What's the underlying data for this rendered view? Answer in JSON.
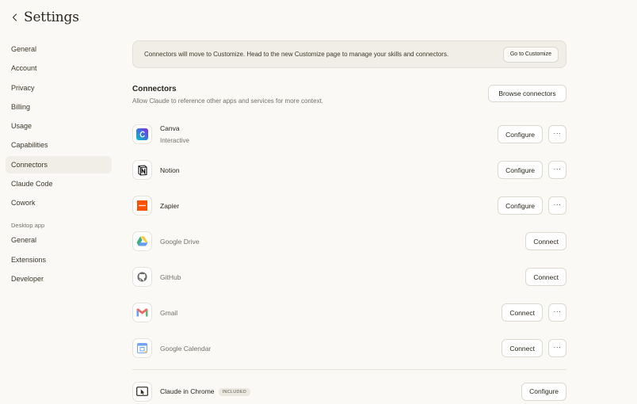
{
  "header": {
    "title": "Settings",
    "back_icon": "chevron-left-icon"
  },
  "sidebar": {
    "items": [
      {
        "label": "General"
      },
      {
        "label": "Account"
      },
      {
        "label": "Privacy"
      },
      {
        "label": "Billing"
      },
      {
        "label": "Usage"
      },
      {
        "label": "Capabilities"
      },
      {
        "label": "Connectors",
        "active": true
      },
      {
        "label": "Claude Code"
      },
      {
        "label": "Cowork"
      }
    ],
    "desktop_section_label": "Desktop app",
    "desktop_items": [
      {
        "label": "General"
      },
      {
        "label": "Extensions"
      },
      {
        "label": "Developer"
      }
    ]
  },
  "banner": {
    "text": "Connectors will move to Customize. Head to the new Customize page to manage your skills and connectors.",
    "button_label": "Go to Customize"
  },
  "connectors": {
    "title": "Connectors",
    "subtitle": "Allow Claude to reference other apps and services for more context.",
    "browse_label": "Browse connectors",
    "list": [
      {
        "name": "Canva",
        "subtitle": "Interactive",
        "action": "Configure",
        "more": "···",
        "icon": "canva-icon"
      },
      {
        "name": "Notion",
        "action": "Configure",
        "more": "···",
        "icon": "notion-icon"
      },
      {
        "name": "Zapier",
        "action": "Configure",
        "more": "···",
        "icon": "zapier-icon"
      },
      {
        "name": "Google Drive",
        "action": "Connect",
        "icon": "google-drive-icon"
      },
      {
        "name": "GitHub",
        "action": "Connect",
        "icon": "github-icon"
      },
      {
        "name": "Gmail",
        "action": "Connect",
        "more": "···",
        "icon": "gmail-icon"
      },
      {
        "name": "Google Calendar",
        "action": "Connect",
        "more": "···",
        "icon": "google-calendar-icon"
      }
    ],
    "chrome": {
      "name": "Claude in Chrome",
      "badge": "INCLUDED",
      "action": "Configure",
      "icon": "chrome-cursor-icon"
    }
  },
  "colors": {
    "background": "#faf9f5",
    "sidebar_active": "#f0eee6",
    "banner_bg": "#f0eee6",
    "zapier": "#ff4f00",
    "canva": "#7d2ae8"
  }
}
